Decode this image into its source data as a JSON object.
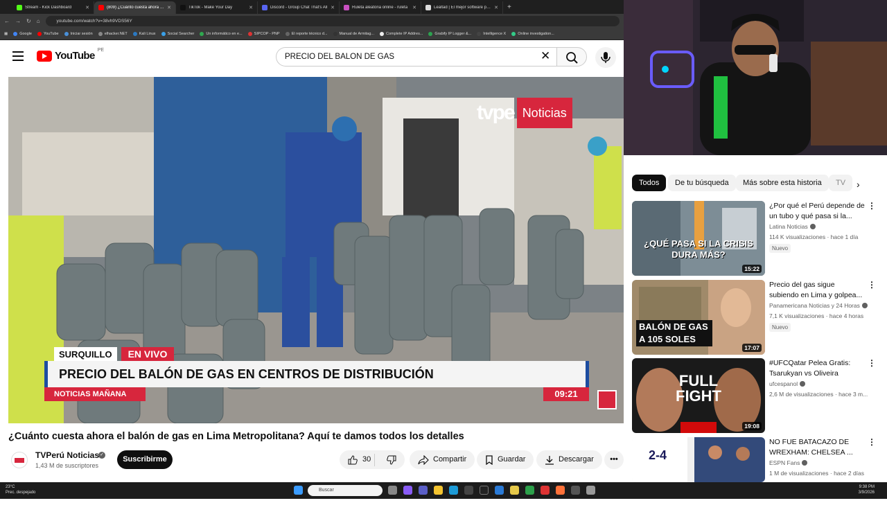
{
  "browser": {
    "tabs": [
      {
        "title": "Stream - Kick Dashboard",
        "color": "#53fc18",
        "active": false
      },
      {
        "title": "(809) ¿Cuánto cuesta ahora el b",
        "color": "#ff0000",
        "active": true
      },
      {
        "title": "TikTok - Make Your Day",
        "color": "#111111",
        "active": false
      },
      {
        "title": "Discord - Group Chat That's All",
        "color": "#5865f2",
        "active": false
      },
      {
        "title": "Ruleta aleatoria online - ruleta",
        "color": "#c850c0",
        "active": false
      },
      {
        "title": "Lealtad | El mejor software para",
        "color": "#dddddd",
        "active": false
      }
    ],
    "new_tab": "+",
    "url": "youtube.com/watch?v=38vh9VDS56Y",
    "bookmarks": [
      {
        "label": "Google",
        "color": "#4285f4"
      },
      {
        "label": "YouTube",
        "color": "#ff0000"
      },
      {
        "label": "Iniciar sesión",
        "color": "#4a90d9"
      },
      {
        "label": "elhacker.NET",
        "color": "#888888"
      },
      {
        "label": "Kali Linux",
        "color": "#2b79c2"
      },
      {
        "label": "Social Searcher",
        "color": "#3aa0e8"
      },
      {
        "label": "Un informático en e...",
        "color": "#2fa84f"
      },
      {
        "label": "SIPCOP - PNP",
        "color": "#d33"
      },
      {
        "label": "El reporte técnico d...",
        "color": "#666666"
      },
      {
        "label": "Manual de Armitag...",
        "color": "#333333"
      },
      {
        "label": "Complete IP Addres...",
        "color": "#eeeeee"
      },
      {
        "label": "Grabify IP Logger &...",
        "color": "#2ca24f"
      },
      {
        "label": "Intelligence X",
        "color": "#444444"
      },
      {
        "label": "Online investigation...",
        "color": "#3c8"
      }
    ]
  },
  "youtube": {
    "logo_text": "YouTube",
    "country": "PE",
    "search_query": "PRECIO DEL BALON DE GAS",
    "clear_symbol": "✕"
  },
  "video": {
    "overlay_brand": "tvpe",
    "overlay_brand_suffix": "Noticias",
    "lower_third_location": "SURQUILLO",
    "lower_third_live": "EN VIVO",
    "lower_third_headline": "PRECIO DEL BALÓN DE GAS EN CENTROS DE DISTRIBUCIÓN",
    "lower_third_program": "NOTICIAS MAÑANA",
    "lower_third_time": "09:21",
    "title": "¿Cuánto cuesta ahora el balón de gas en Lima Metropolitana? Aquí te damos todos los detalles",
    "channel": "TVPerú Noticias",
    "subscribers": "1,43 M de suscriptores",
    "subscribe_label": "Suscribirme",
    "likes": "30",
    "share_label": "Compartir",
    "save_label": "Guardar",
    "download_label": "Descargar",
    "more_label": "•••"
  },
  "sidebar": {
    "chips": [
      "Todos",
      "De tu búsqueda",
      "Más sobre esta historia",
      "TV"
    ],
    "chip_next": "›",
    "videos": [
      {
        "title": "¿Por qué el Perú depende de un tubo y qué pasa si la...",
        "channel": "Latina Noticias",
        "meta": "114 K visualizaciones · hace 1 día",
        "badge": "Nuevo",
        "duration": "15:22",
        "thumb_text": "¿QUÉ PASA SI LA CRISIS DURA MÁS?"
      },
      {
        "title": "Precio del gas sigue subiendo en Lima y golpea...",
        "channel": "Panamericana Noticias y 24 Horas",
        "meta": "7,1 K visualizaciones · hace 4 horas",
        "badge": "Nuevo",
        "duration": "17:07",
        "thumb_text": "BALÓN DE GAS A 105 SOLES"
      },
      {
        "title": "#UFCQatar Pelea Gratis: Tsarukyan vs Oliveira",
        "channel": "ufcespanol",
        "meta": "2,6 M de visualizaciones · hace 3 m...",
        "badge": "",
        "duration": "19:08",
        "thumb_text": "FULL FIGHT"
      },
      {
        "title": "NO FUE BATACAZO DE WREXHAM: CHELSEA ...",
        "channel": "ESPN Fans",
        "meta": "1 M de visualizaciones · hace 2 días",
        "badge": "",
        "duration": "",
        "thumb_text": "2-4"
      }
    ],
    "kebab": "⋮"
  },
  "taskbar": {
    "weather_temp": "23°C",
    "weather_desc": "Prec. despejado",
    "search_placeholder": "Buscar",
    "time": "9:38 PM",
    "date": "3/9/2026"
  }
}
